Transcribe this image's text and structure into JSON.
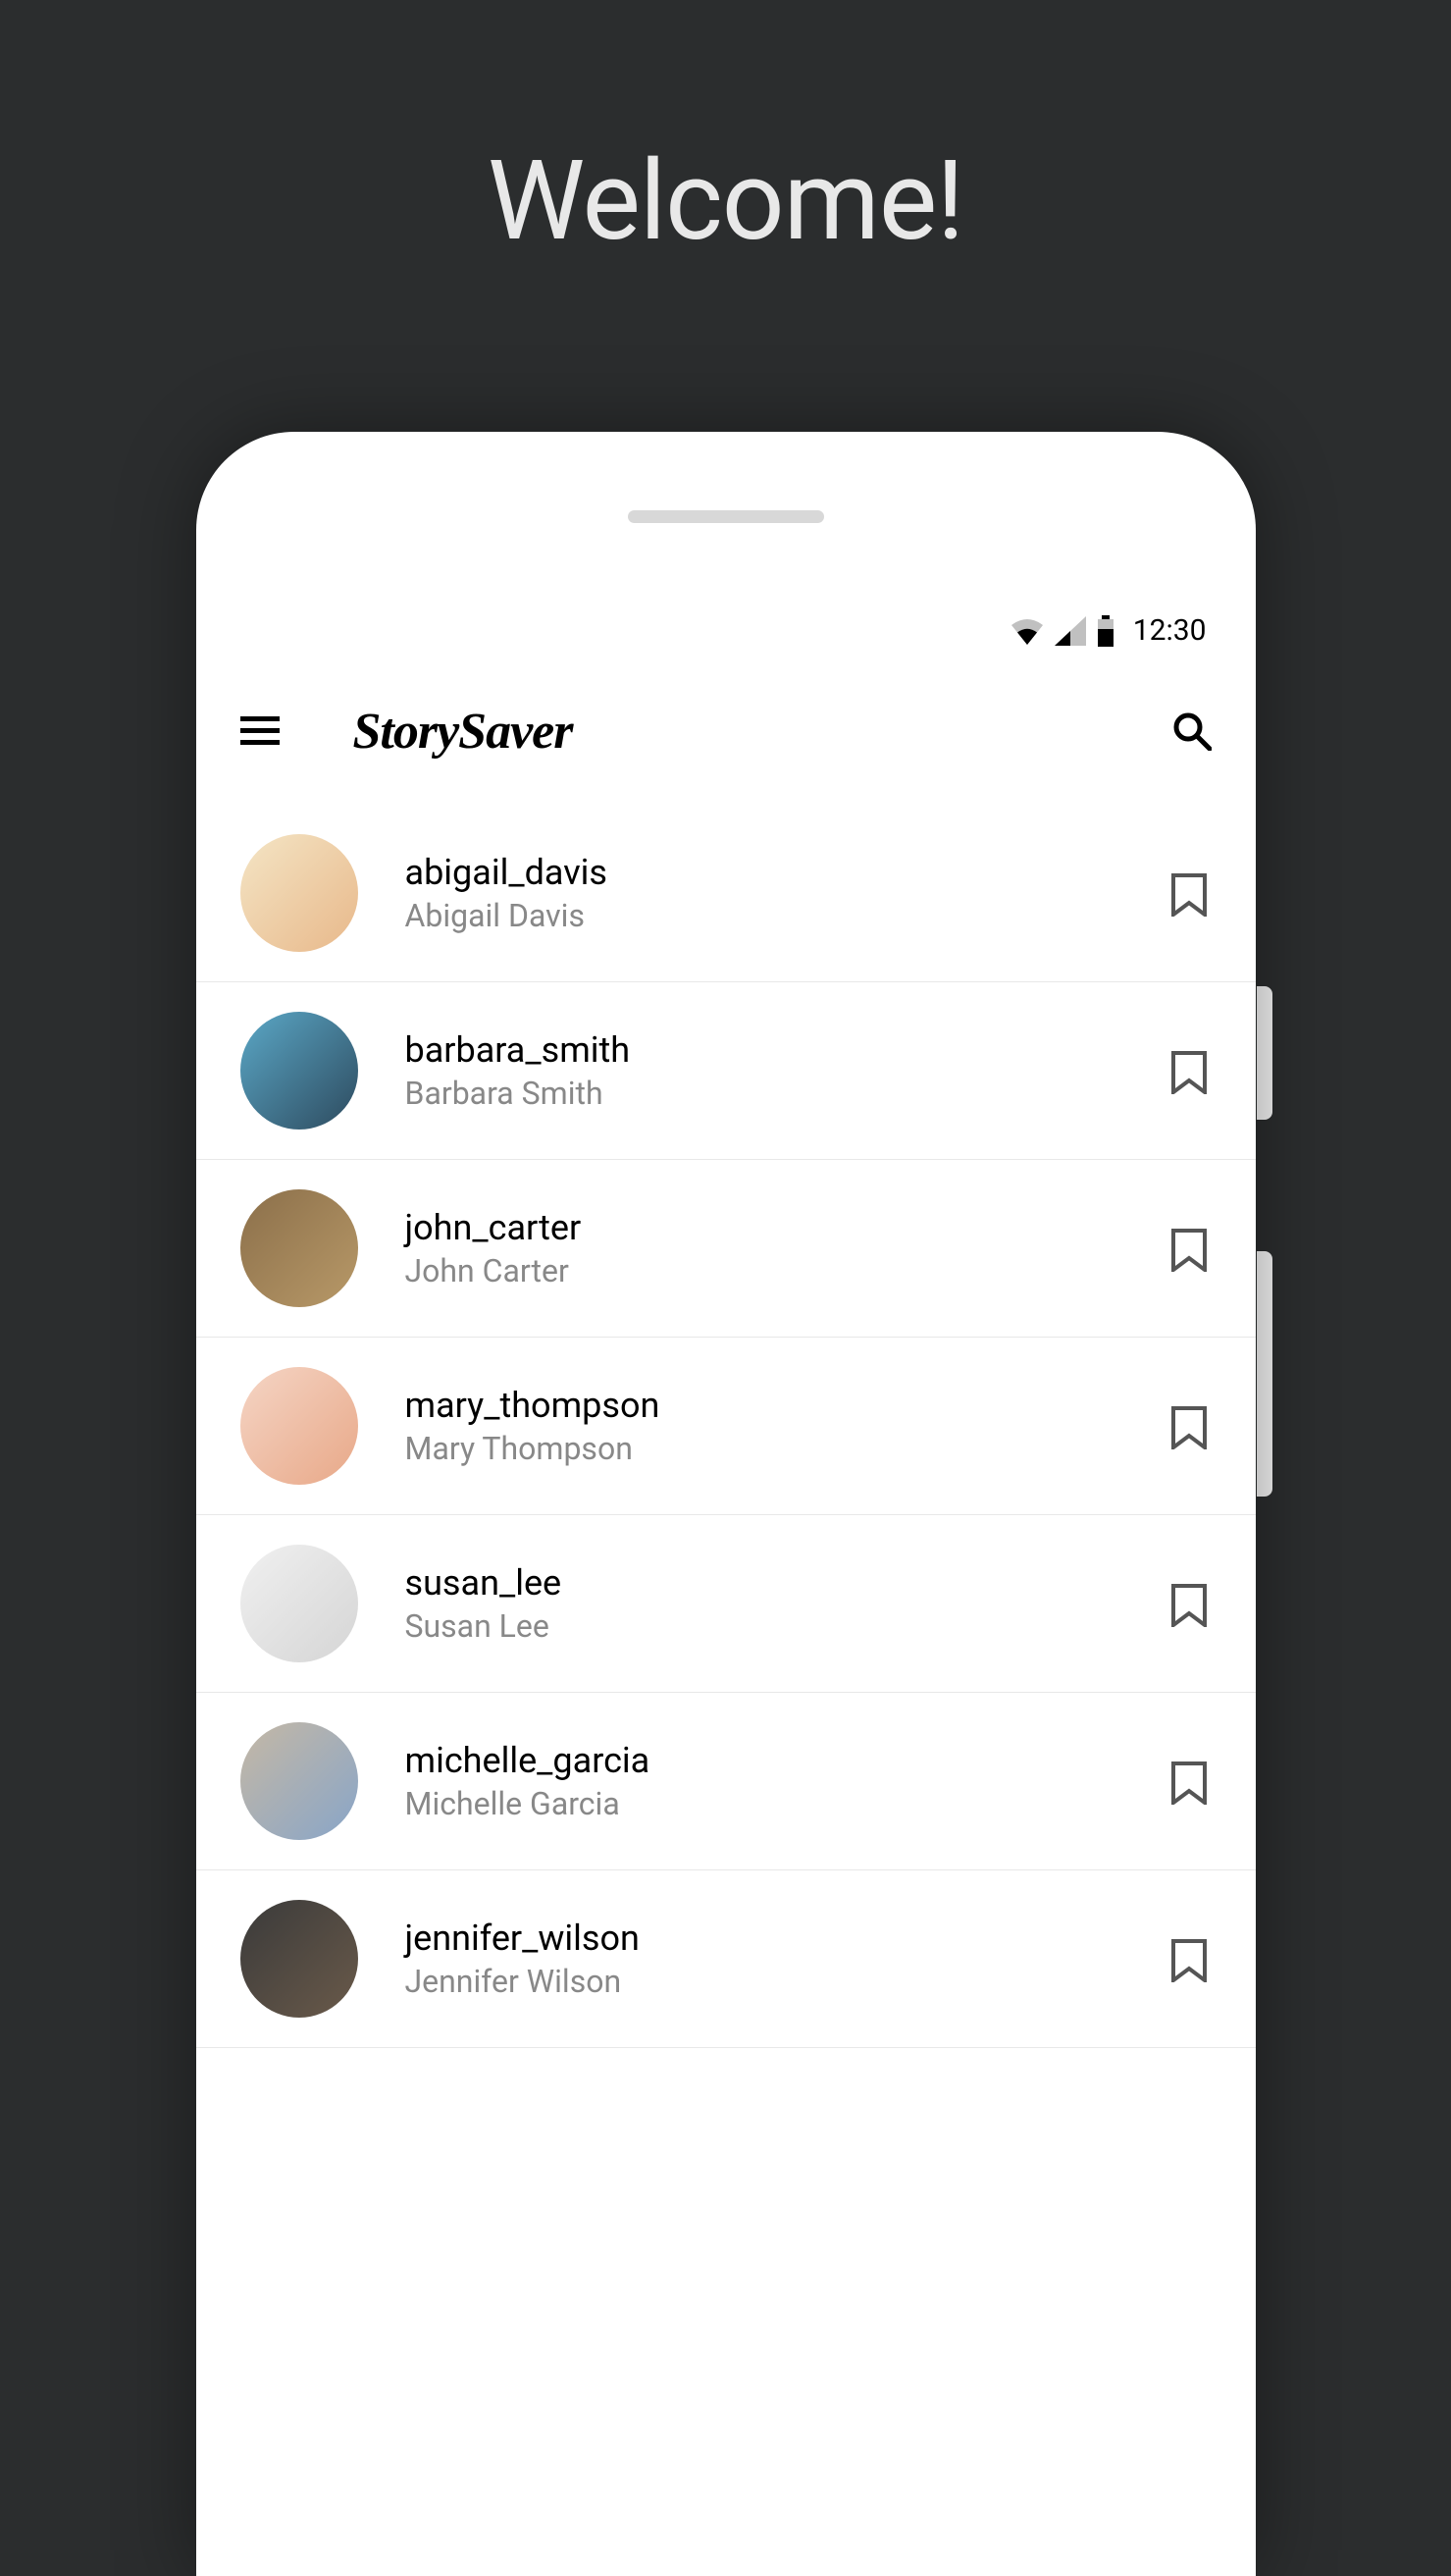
{
  "page": {
    "welcome": "Welcome!"
  },
  "statusBar": {
    "time": "12:30"
  },
  "header": {
    "appName": "StorySaver"
  },
  "users": [
    {
      "username": "abigail_davis",
      "fullname": "Abigail Davis"
    },
    {
      "username": "barbara_smith",
      "fullname": "Barbara Smith"
    },
    {
      "username": "john_carter",
      "fullname": "John Carter"
    },
    {
      "username": "mary_thompson",
      "fullname": "Mary Thompson"
    },
    {
      "username": "susan_lee",
      "fullname": "Susan Lee"
    },
    {
      "username": "michelle_garcia",
      "fullname": "Michelle Garcia"
    },
    {
      "username": "jennifer_wilson",
      "fullname": "Jennifer Wilson"
    }
  ]
}
